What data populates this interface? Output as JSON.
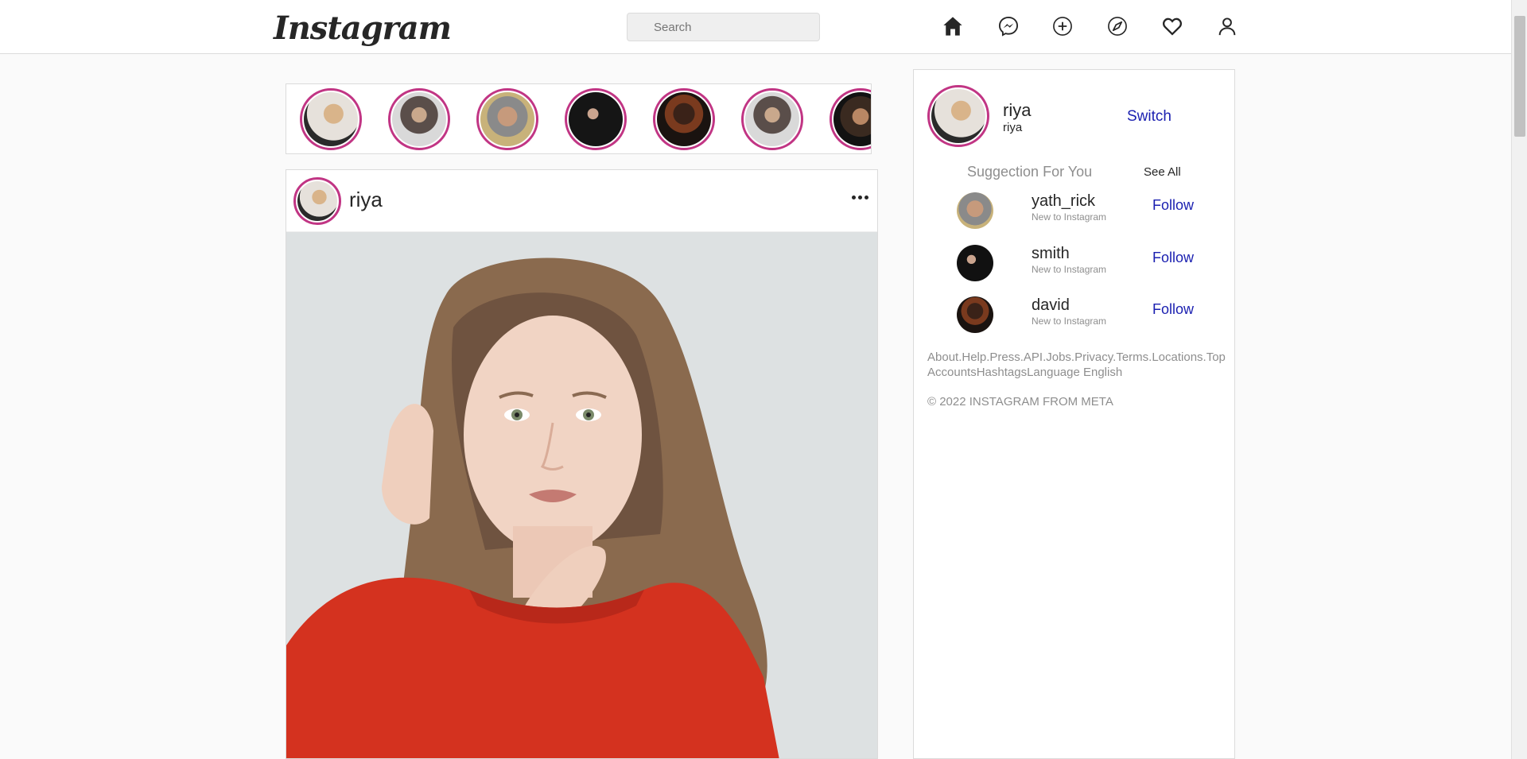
{
  "header": {
    "logo": "Instagram",
    "search_placeholder": "Search",
    "icons": [
      "home-icon",
      "messenger-icon",
      "create-icon",
      "explore-icon",
      "activity-heart-icon",
      "profile-icon"
    ]
  },
  "stories": [
    "story-1",
    "story-2",
    "story-3",
    "story-4",
    "story-5",
    "story-6",
    "story-7"
  ],
  "post": {
    "username": "riya",
    "more_icon": "more-options-icon"
  },
  "sidebar": {
    "username": "riya",
    "name": "riya",
    "switch_label": "Switch",
    "suggestions_title": "Suggection For You",
    "see_all_label": "See All",
    "suggestions": [
      {
        "username": "yath_rick",
        "subtitle": "New to Instagram",
        "follow_label": "Follow"
      },
      {
        "username": "smith",
        "subtitle": "New to Instagram",
        "follow_label": "Follow"
      },
      {
        "username": "david",
        "subtitle": "New to Instagram",
        "follow_label": "Follow"
      }
    ],
    "footer_links": "About.Help.Press.API.Jobs.Privacy.Terms.Locations.Top AccountsHashtagsLanguage English",
    "copyright": "© 2022 INSTAGRAM FROM META"
  },
  "colors": {
    "story_ring": "#c13584",
    "link_blue": "#1a1fb0",
    "muted_text": "#8e8e8e"
  }
}
